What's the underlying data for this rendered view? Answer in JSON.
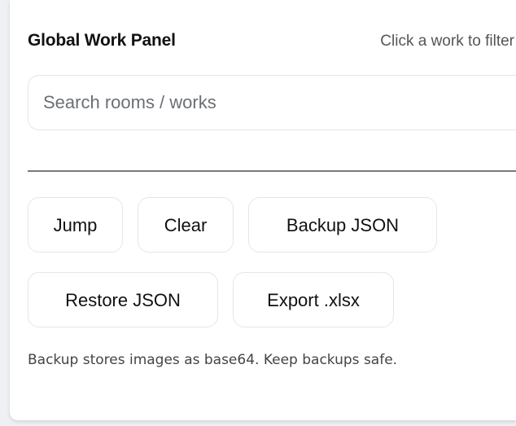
{
  "panel": {
    "title": "Global Work Panel",
    "hint": "Click a work to filter"
  },
  "search": {
    "placeholder": "Search rooms / works",
    "value": ""
  },
  "actions": {
    "jump": "Jump",
    "clear": "Clear",
    "backup_json": "Backup JSON",
    "restore_json": "Restore JSON",
    "export_xlsx": "Export .xlsx"
  },
  "note": "Backup stores images as base64. Keep backups safe."
}
